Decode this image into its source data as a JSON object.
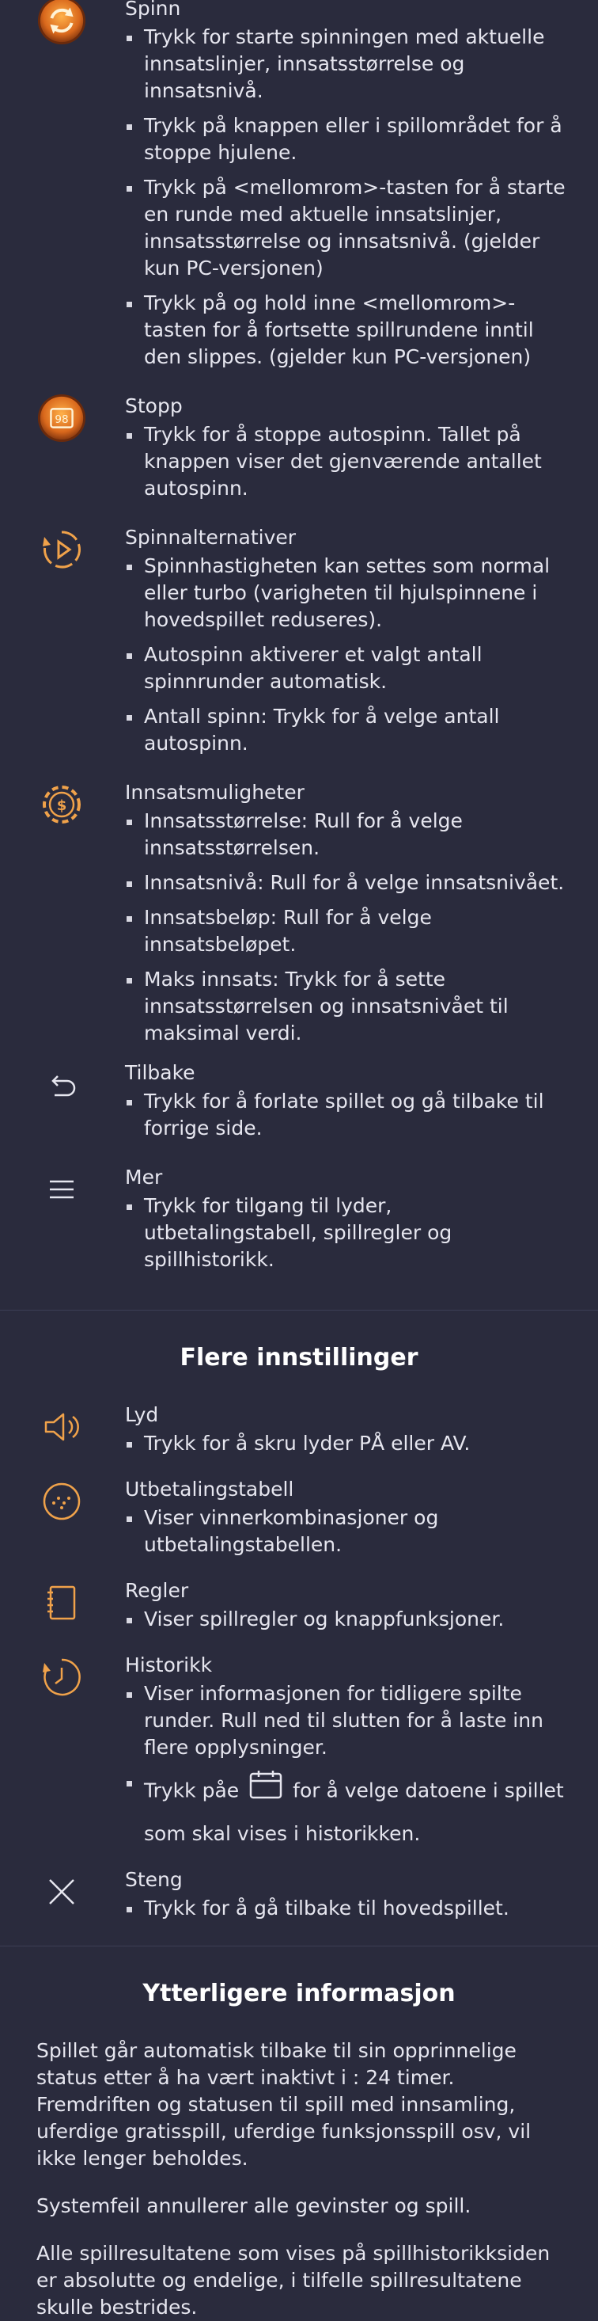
{
  "controls": [
    {
      "icon": "spin-icon",
      "title": "Spinn",
      "bullets": [
        "Trykk for starte spinningen med aktuelle innsatslinjer, innsatsstørrelse og innsatsnivå.",
        "Trykk på knappen eller i spillområdet for å stoppe hjulene.",
        "Trykk på <mellomrom>-tasten for å starte en runde med aktuelle innsatslinjer, innsatsstørrelse og innsatsnivå. (gjelder kun PC-versjonen)",
        "Trykk på og hold inne <mellomrom>-tasten for å fortsette spillrundene inntil den slippes. (gjelder kun PC-versjonen)"
      ]
    },
    {
      "icon": "stop-autospin-icon",
      "icon_number": "98",
      "title": "Stopp",
      "bullets": [
        "Trykk for å stoppe autospinn. Tallet på knappen viser det gjenværende antallet autospinn."
      ]
    },
    {
      "icon": "spin-options-icon",
      "title": "Spinnalternativer",
      "bullets": [
        "Spinnhastigheten kan settes som normal eller turbo (varigheten til hjulspinnene i hovedspillet reduseres).",
        "Autospinn aktiverer et valgt antall spinnrunder automatisk.",
        "Antall spinn: Trykk for å velge antall autospinn."
      ]
    },
    {
      "icon": "bet-options-icon",
      "title": "Innsatsmuligheter",
      "bullets": [
        "Innsatsstørrelse: Rull for å velge innsatsstørrelsen.",
        "Innsatsnivå: Rull for å velge innsatsnivået.",
        "Innsatsbeløp: Rull for å velge innsatsbeløpet.",
        "Maks innsats: Trykk for å sette innsatsstørrelsen og innsatsnivået til maksimal verdi."
      ]
    },
    {
      "icon": "back-icon",
      "title": "Tilbake",
      "bullets": [
        "Trykk for å forlate spillet og gå tilbake til forrige side."
      ]
    },
    {
      "icon": "menu-icon",
      "title": "Mer",
      "bullets": [
        "Trykk for tilgang til lyder, utbetalingstabell, spillregler og spillhistorikk."
      ]
    }
  ],
  "more_settings": {
    "heading": "Flere innstillinger",
    "items": [
      {
        "icon": "sound-icon",
        "title": "Lyd",
        "bullets": [
          "Trykk for å skru lyder PÅ eller AV."
        ]
      },
      {
        "icon": "paytable-icon",
        "title": "Utbetalingstabell",
        "bullets": [
          "Viser vinnerkombinasjoner og utbetalingstabellen."
        ]
      },
      {
        "icon": "rules-icon",
        "title": "Regler",
        "bullets": [
          "Viser spillregler og knappfunksjoner."
        ]
      },
      {
        "icon": "history-icon",
        "title": "Historikk",
        "bullets": [
          "Viser informasjonen for tidligere spilte runder. Rull ned til slutten for å laste inn flere opplysninger."
        ],
        "calendar_line_before": "Trykk påe",
        "calendar_line_after": "for å velge datoene i spillet som skal vises i historikken."
      },
      {
        "icon": "close-icon",
        "title": "Steng",
        "bullets": [
          "Trykk for å gå tilbake til hovedspillet."
        ]
      }
    ]
  },
  "additional_info": {
    "heading": "Ytterligere informasjon",
    "paragraphs": [
      "Spillet går automatisk tilbake til sin opprinnelige status etter å ha vært inaktivt i : 24 timer. Fremdriften og statusen til spill med innsamling, uferdige gratisspill, uferdige funksjonsspill osv, vil ikke lenger beholdes.",
      "Systemfeil annullerer alle gevinster og spill.",
      "Alle spillresultatene som vises på spillhistorikksiden er absolutte og endelige, i tilfelle spillresultatene skulle bestrides."
    ]
  },
  "colors": {
    "background": "#2a2b3d",
    "accent": "#f0a24a",
    "text": "#e6e6ef"
  }
}
